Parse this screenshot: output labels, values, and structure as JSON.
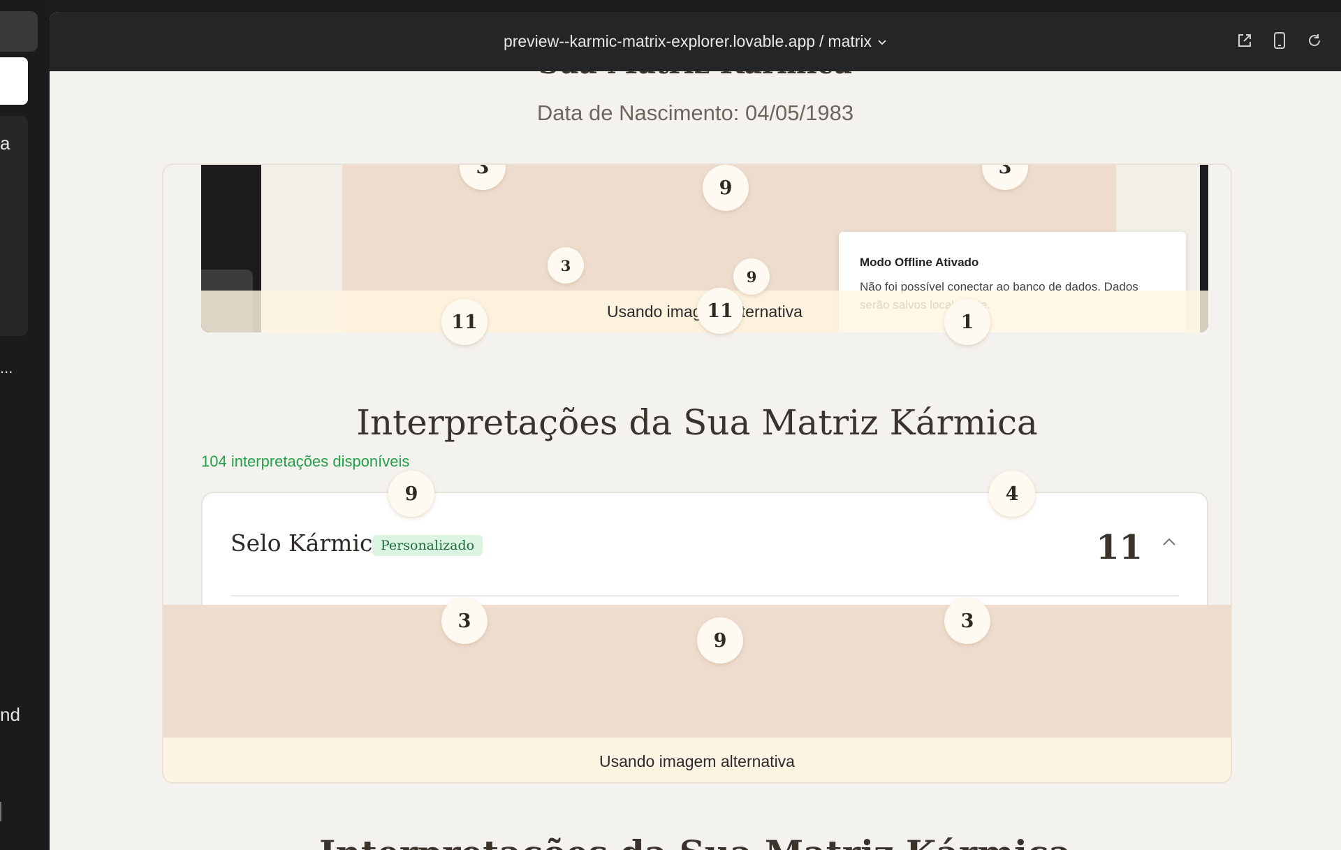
{
  "browser": {
    "url_host": "preview--karmic-matrix-explorer.lovable.app",
    "url_sep": "/",
    "url_path": "matrix"
  },
  "left_fragments": {
    "a": "a",
    "dots": "...",
    "nd": "nd"
  },
  "page": {
    "matrix_title": "Sua Matriz Kármica",
    "birth_date": "Data de Nascimento: 04/05/1983",
    "interp_title": "Interpretações da Sua Matriz Kármica",
    "interp_count": "104 interpretações disponíveis",
    "next_title": "Interpretações da Sua Matriz Kármica"
  },
  "embedded": {
    "toast_title": "Modo Offline Ativado",
    "toast_body": "Não foi possível conectar ao banco de dados. Dados serão salvos localmente.",
    "alt_text": "Usando imagem alternativa"
  },
  "matrix_nodes": {
    "n1": "3",
    "n2": "9",
    "n3": "3",
    "n4": "3",
    "n5": "9",
    "n6": "11",
    "n7": "11",
    "n8": "1",
    "n9": "9",
    "n10": "4",
    "n11": "3",
    "n12": "9",
    "n13": "3"
  },
  "selo": {
    "name": "Selo Kármico",
    "badge": "Personalizado",
    "value": "11"
  },
  "bottom": {
    "alt_text": "Usando imagem alternativa"
  }
}
